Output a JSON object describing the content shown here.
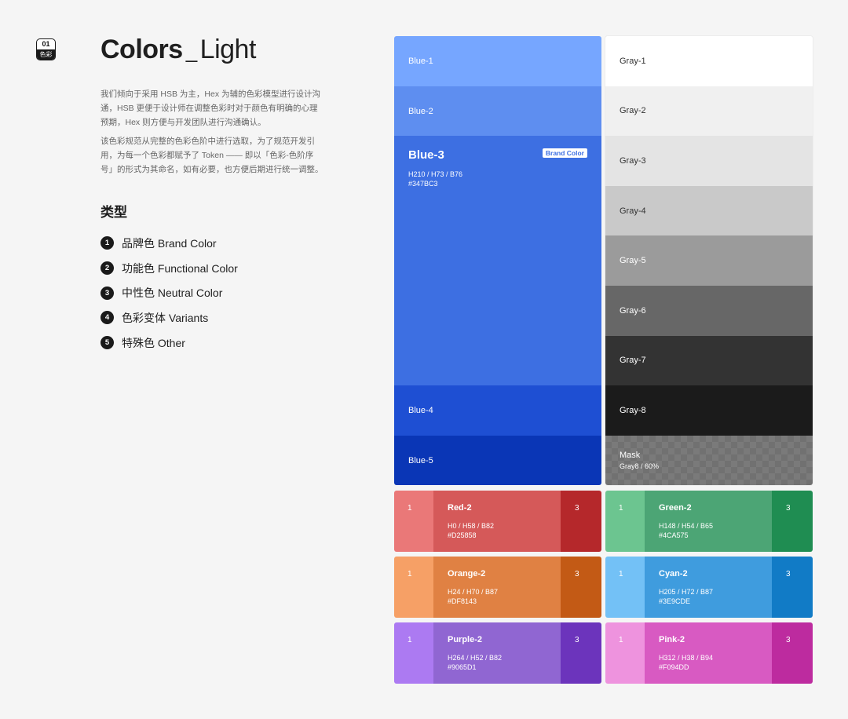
{
  "badge": {
    "num": "01",
    "label": "色彩"
  },
  "title": {
    "bold": "Colors",
    "sep": "_",
    "light": "Light"
  },
  "desc": {
    "p1": "我们倾向于采用 HSB 为主，Hex 为辅的色彩模型进行设计沟通，HSB 更便于设计师在调整色彩时对于颜色有明确的心理预期，Hex 则方便与开发团队进行沟通确认。",
    "p2": "该色彩规范从完整的色彩色阶中进行选取，为了规范开发引用，为每一个色彩都赋予了 Token —— 即以「色彩-色阶序号」的形式为其命名，如有必要，也方便后期进行统一调整。"
  },
  "types": {
    "heading": "类型",
    "items": [
      {
        "n": "1",
        "label": "品牌色  Brand Color"
      },
      {
        "n": "2",
        "label": "功能色  Functional Color"
      },
      {
        "n": "3",
        "label": "中性色  Neutral Color"
      },
      {
        "n": "4",
        "label": "色彩变体 Variants"
      },
      {
        "n": "5",
        "label": "特殊色  Other"
      }
    ]
  },
  "blue": {
    "b1": "Blue-1",
    "b2": "Blue-2",
    "b3": {
      "name": "Blue-3",
      "hsb": "H210 / H73 / B76",
      "hex": "#347BC3",
      "tag": "Brand Color"
    },
    "b4": "Blue-4",
    "b5": "Blue-5"
  },
  "gray": {
    "g1": "Gray-1",
    "g2": "Gray-2",
    "g3": "Gray-3",
    "g4": "Gray-4",
    "g5": "Gray-5",
    "g6": "Gray-6",
    "g7": "Gray-7",
    "g8": "Gray-8",
    "mask": {
      "name": "Mask",
      "sub": "Gray8 / 60%"
    }
  },
  "cards": [
    {
      "n1": "1",
      "name": "Red-2",
      "hsb": "H0 / H58 / B82",
      "hex": "#D25858",
      "n3": "3",
      "colors": [
        "#ea7878",
        "#d55959",
        "#b5282b"
      ]
    },
    {
      "n1": "1",
      "name": "Green-2",
      "hsb": "H148 / H54 / B65",
      "hex": "#4CA575",
      "n3": "3",
      "colors": [
        "#6cc590",
        "#4ca575",
        "#1f8d52"
      ]
    },
    {
      "n1": "1",
      "name": "Orange-2",
      "hsb": "H24 / H70 / B87",
      "hex": "#DF8143",
      "n3": "3",
      "colors": [
        "#f6a066",
        "#e08143",
        "#c35a15"
      ]
    },
    {
      "n1": "1",
      "name": "Cyan-2",
      "hsb": "H205 / H72 / B87",
      "hex": "#3E9CDE",
      "n3": "3",
      "colors": [
        "#73c1f6",
        "#3f9cde",
        "#117bc6"
      ]
    },
    {
      "n1": "1",
      "name": "Purple-2",
      "hsb": "H264 / H52 / B82",
      "hex": "#9065D1",
      "n3": "3",
      "colors": [
        "#ac7af2",
        "#9066d2",
        "#6c34bc"
      ]
    },
    {
      "n1": "1",
      "name": "Pink-2",
      "hsb": "H312 / H38 / B94",
      "hex": "#F094DD",
      "n3": "3",
      "colors": [
        "#ee93de",
        "#d85ac2",
        "#bd2b9f"
      ]
    }
  ]
}
